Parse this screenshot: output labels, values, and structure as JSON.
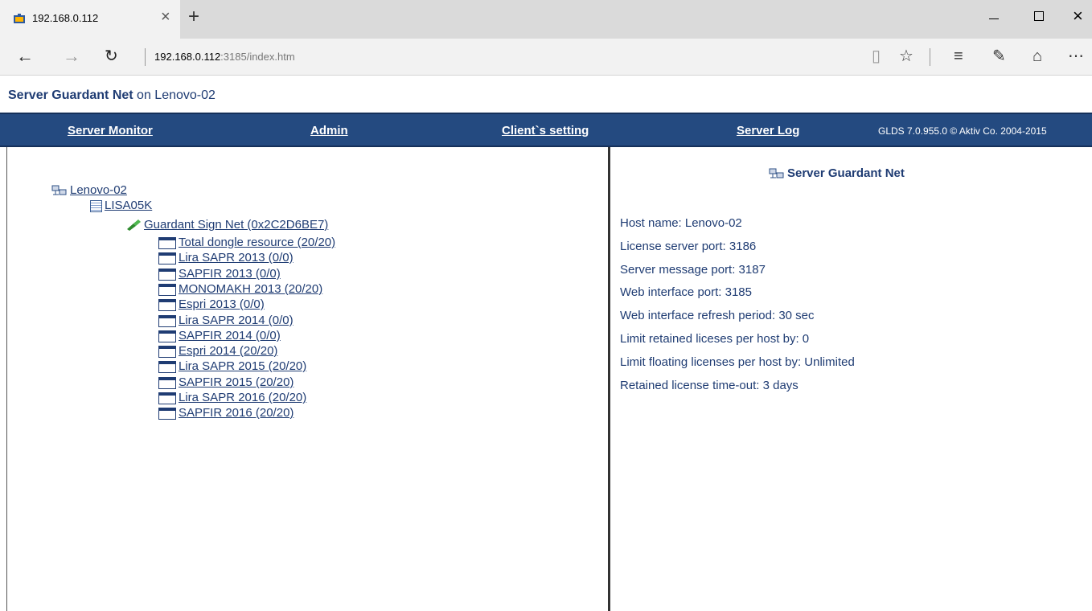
{
  "browser": {
    "tab_title": "192.168.0.112",
    "url_host": "192.168.0.112",
    "url_path": ":3185/index.htm"
  },
  "page": {
    "title_strong": "Server Guardant Net",
    "title_rest": " on Lenovo-02"
  },
  "nav": {
    "server_monitor": "Server Monitor",
    "admin": "Admin",
    "client_setting": "Client`s setting",
    "server_log": "Server Log",
    "version": "GLDS 7.0.955.0 © Aktiv Co. 2004-2015"
  },
  "tree": {
    "server": "Lenovo-02",
    "host": "LISA05K",
    "dongle": "Guardant Sign Net (0x2C2D6BE7)",
    "items": [
      "Total dongle resource (20/20)",
      "Lira SAPR 2013 (0/0)",
      "SAPFIR 2013 (0/0)",
      "MONOMAKH 2013 (20/20)",
      "Espri 2013 (0/0)",
      "Lira SAPR 2014 (0/0)",
      "SAPFIR 2014 (0/0)",
      "Espri 2014 (20/20)",
      "Lira SAPR 2015 (20/20)",
      "SAPFIR 2015 (20/20)",
      "Lira SAPR 2016 (20/20)",
      "SAPFIR 2016 (20/20)"
    ]
  },
  "info": {
    "header": "Server Guardant Net",
    "lines": [
      "Host name: Lenovo-02",
      "License server port: 3186",
      "Server message port: 3187",
      "Web interface port: 3185",
      "Web interface refresh period: 30 sec",
      "Limit retained liceses per host by: 0",
      "Limit floating licenses per host by: Unlimited",
      "Retained license time-out: 3 days"
    ]
  },
  "colors": {
    "navbar": "#244a80",
    "link": "#1f3c73"
  }
}
